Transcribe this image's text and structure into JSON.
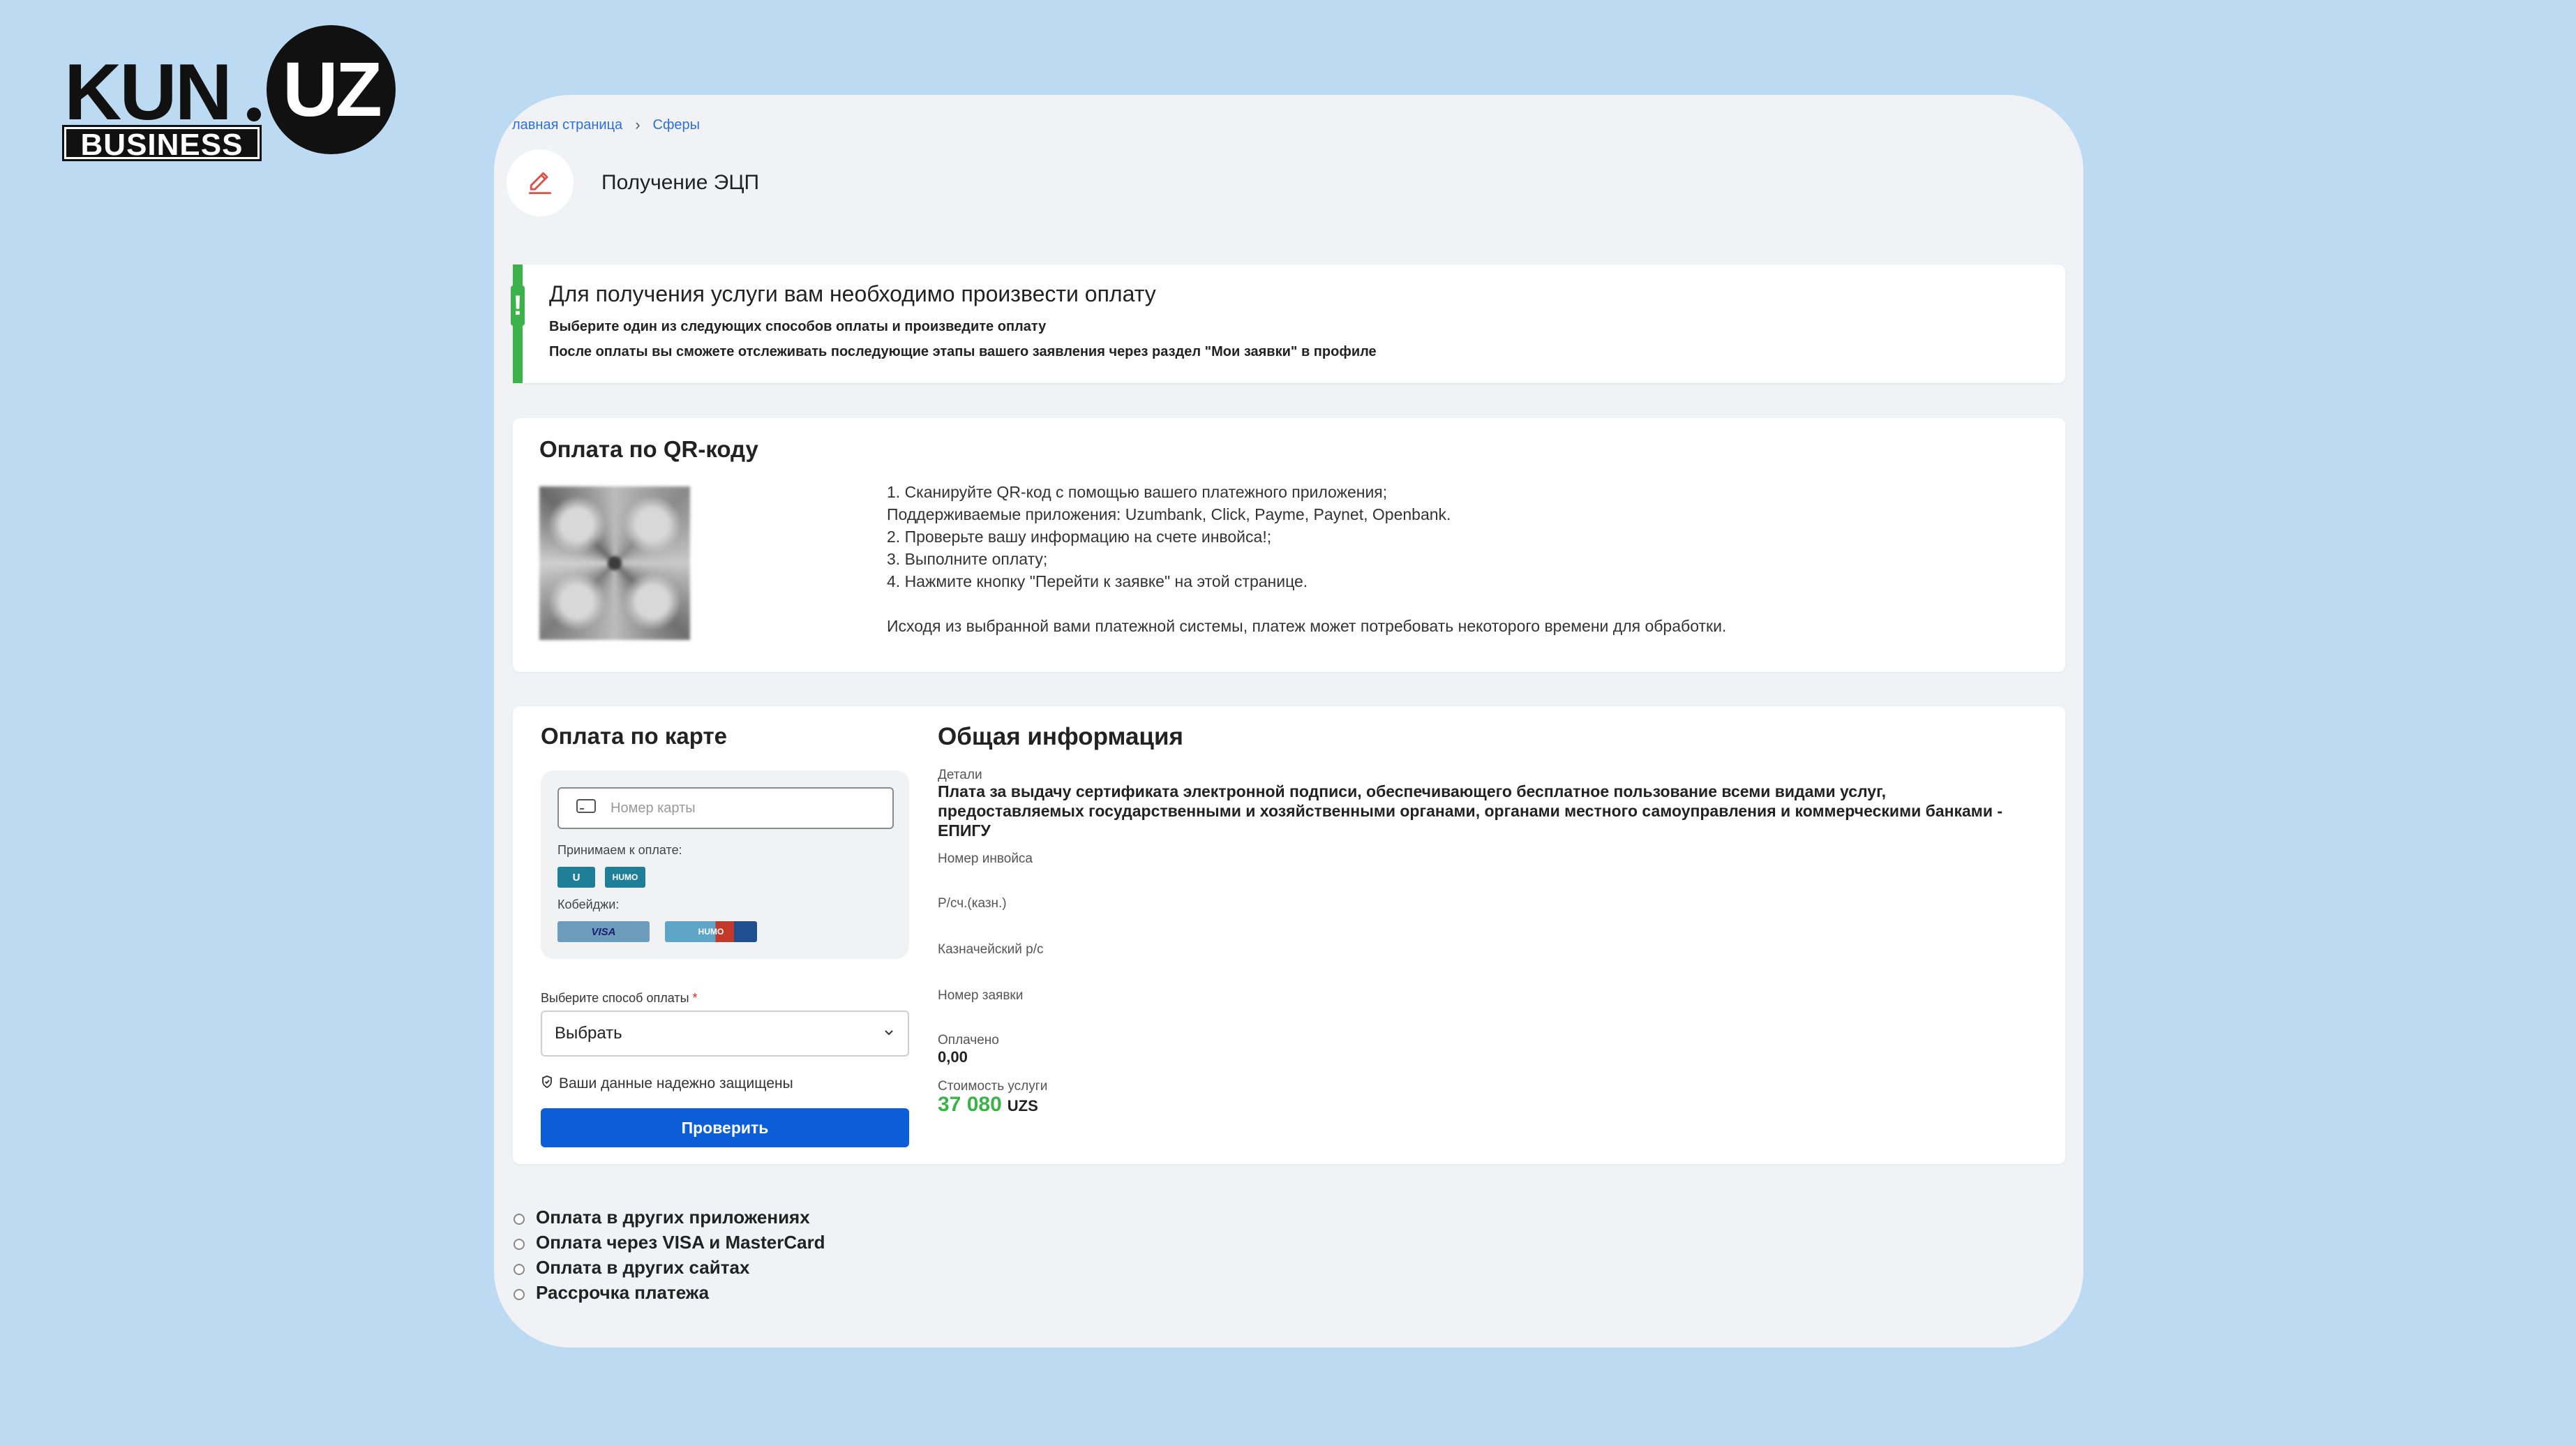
{
  "logo": {
    "kun": "KUN",
    "uz": "UZ",
    "business": "BUSINESS"
  },
  "breadcrumb": {
    "home": "лавная страница",
    "current": "Сферы"
  },
  "page": {
    "title": "Получение ЭЦП"
  },
  "notice": {
    "title": "Для получения услуги вам необходимо произвести оплату",
    "line1": "Выберите один из следующих способов оплаты и произведите оплату",
    "line2": "После оплаты вы сможете отслеживать последующие этапы вашего заявления через раздел \"Мои заявки\" в профиле"
  },
  "qr": {
    "title": "Оплата по QR-коду",
    "steps": [
      "1. Сканируйте QR-код с помощью вашего платежного приложения;",
      "Поддерживаемые приложения: Uzumbank, Click, Payme, Paynet, Openbank.",
      "2. Проверьте вашу информацию на счете инвойса!;",
      "3. Выполните оплату;",
      "4. Нажмите кнопку \"Перейти к заявке\" на этой странице."
    ],
    "note": "Исходя из выбранной вами платежной системы, платеж может потребовать некоторого времени для обработки."
  },
  "card_payment": {
    "title": "Оплата по карте",
    "card_placeholder": "Номер карты",
    "accepted_label": "Принимаем к оплате:",
    "cobadge_label": "Кобейджи:",
    "badges": {
      "uzcard": "U",
      "humo": "HUMO",
      "uzcard_visa": "VISA",
      "humo_unionpay": "HUMO"
    },
    "method_label": "Выберите способ оплаты",
    "method_required": "*",
    "method_value": "Выбрать",
    "secure_text": "Ваши данные надежно защищены",
    "check_button": "Проверить"
  },
  "info": {
    "title": "Общая информация",
    "details_label": "Детали",
    "details_value": "Плата за выдачу сертификата электронной подписи, обеспечивающего бесплатное пользование всеми видами услуг, предоставляемых государственными и хозяйственными органами, органами местного самоуправления и коммерческими банками - ЕПИГУ",
    "invoice_label": "Номер инвойса",
    "account_label": "Р/сч.(казн.)",
    "treasury_label": "Казначейский р/с",
    "application_label": "Номер заявки",
    "paid_label": "Оплачено",
    "paid_value": "0,00",
    "cost_label": "Стоимость услуги",
    "cost_value": "37 080",
    "currency": "UZS"
  },
  "other_options": [
    "Оплата в других приложениях",
    "Оплата через VISA и MasterCard",
    "Оплата в других сайтах",
    "Рассрочка платежа"
  ],
  "colors": {
    "accent_blue": "#0b5ed7",
    "success_green": "#3cb34a",
    "background": "#bcdaf1"
  }
}
